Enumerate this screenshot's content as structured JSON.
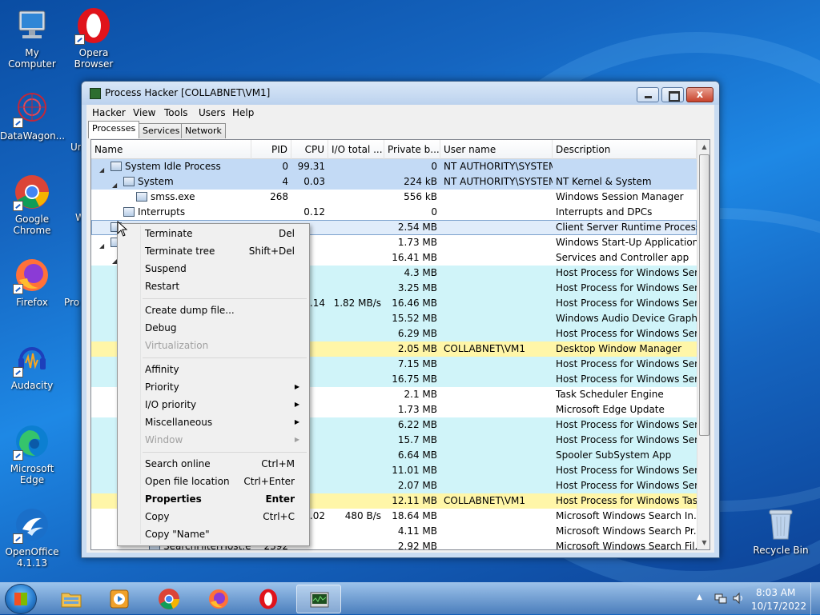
{
  "desktop": {
    "icons": [
      {
        "label": "My Computer"
      },
      {
        "label": "Opera Browser"
      },
      {
        "label": "DataWagon..."
      },
      {
        "label": "Google Chrome"
      },
      {
        "label": "Firefox"
      },
      {
        "label": "Audacity"
      },
      {
        "label": "Microsoft Edge"
      },
      {
        "label": "OpenOffice 4.1.13"
      },
      {
        "label": "Recycle Bin"
      },
      {
        "label": "Ur"
      },
      {
        "label": "W"
      },
      {
        "label": "Pro"
      }
    ]
  },
  "window": {
    "title": "Process Hacker [COLLABNET\\VM1]",
    "close_glyph": "x",
    "menu": [
      "Hacker",
      "View",
      "Tools",
      "Users",
      "Help"
    ],
    "tabs": [
      "Processes",
      "Services",
      "Network"
    ],
    "columns": [
      "Name",
      "PID",
      "CPU",
      "I/O total ...",
      "Private b...",
      "User name",
      "Description"
    ],
    "rows": [
      {
        "name": "System Idle Process",
        "pid": "0",
        "cpu": "99.31",
        "io": "",
        "priv": "0",
        "user": "NT AUTHORITY\\SYSTEM",
        "desc": ""
      },
      {
        "name": "System",
        "pid": "4",
        "cpu": "0.03",
        "io": "",
        "priv": "224 kB",
        "user": "NT AUTHORITY\\SYSTEM",
        "desc": "NT Kernel & System"
      },
      {
        "name": "smss.exe",
        "pid": "268",
        "cpu": "",
        "io": "",
        "priv": "556 kB",
        "user": "",
        "desc": "Windows Session Manager"
      },
      {
        "name": "Interrupts",
        "pid": "",
        "cpu": "0.12",
        "io": "",
        "priv": "0",
        "user": "",
        "desc": "Interrupts and DPCs"
      },
      {
        "name": "",
        "pid": "",
        "cpu": "",
        "io": "",
        "priv": "2.54 MB",
        "user": "",
        "desc": "Client Server Runtime Process"
      },
      {
        "name": "",
        "pid": "",
        "cpu": "",
        "io": "",
        "priv": "1.73 MB",
        "user": "",
        "desc": "Windows Start-Up Application"
      },
      {
        "name": "",
        "pid": "",
        "cpu": "",
        "io": "",
        "priv": "16.41 MB",
        "user": "",
        "desc": "Services and Controller app"
      },
      {
        "name": "",
        "pid": "",
        "cpu": "",
        "io": "",
        "priv": "4.3 MB",
        "user": "",
        "desc": "Host Process for Windows Ser..."
      },
      {
        "name": "",
        "pid": "",
        "cpu": "",
        "io": "",
        "priv": "3.25 MB",
        "user": "",
        "desc": "Host Process for Windows Ser..."
      },
      {
        "name": "",
        "pid": "",
        "cpu": ".14",
        "io": "1.82 MB/s",
        "priv": "16.46 MB",
        "user": "",
        "desc": "Host Process for Windows Ser..."
      },
      {
        "name": "",
        "pid": "",
        "cpu": "",
        "io": "",
        "priv": "15.52 MB",
        "user": "",
        "desc": "Windows Audio Device Graph..."
      },
      {
        "name": "",
        "pid": "",
        "cpu": "",
        "io": "",
        "priv": "6.29 MB",
        "user": "",
        "desc": "Host Process for Windows Ser..."
      },
      {
        "name": "",
        "pid": "",
        "cpu": "",
        "io": "",
        "priv": "2.05 MB",
        "user": "COLLABNET\\VM1",
        "desc": "Desktop Window Manager"
      },
      {
        "name": "",
        "pid": "",
        "cpu": "",
        "io": "",
        "priv": "7.15 MB",
        "user": "",
        "desc": "Host Process for Windows Ser..."
      },
      {
        "name": "",
        "pid": "",
        "cpu": "",
        "io": "",
        "priv": "16.75 MB",
        "user": "",
        "desc": "Host Process for Windows Ser..."
      },
      {
        "name": "",
        "pid": "",
        "cpu": "",
        "io": "",
        "priv": "2.1 MB",
        "user": "",
        "desc": "Task Scheduler Engine"
      },
      {
        "name": "",
        "pid": "",
        "cpu": "",
        "io": "",
        "priv": "1.73 MB",
        "user": "",
        "desc": "Microsoft Edge Update"
      },
      {
        "name": "",
        "pid": "",
        "cpu": "",
        "io": "",
        "priv": "6.22 MB",
        "user": "",
        "desc": "Host Process for Windows Ser..."
      },
      {
        "name": "",
        "pid": "",
        "cpu": "",
        "io": "",
        "priv": "15.7 MB",
        "user": "",
        "desc": "Host Process for Windows Ser..."
      },
      {
        "name": "",
        "pid": "",
        "cpu": "",
        "io": "",
        "priv": "6.64 MB",
        "user": "",
        "desc": "Spooler SubSystem App"
      },
      {
        "name": "",
        "pid": "",
        "cpu": "",
        "io": "",
        "priv": "11.01 MB",
        "user": "",
        "desc": "Host Process for Windows Ser..."
      },
      {
        "name": "",
        "pid": "",
        "cpu": "",
        "io": "",
        "priv": "2.07 MB",
        "user": "",
        "desc": "Host Process for Windows Ser..."
      },
      {
        "name": "",
        "pid": "",
        "cpu": "",
        "io": "",
        "priv": "12.11 MB",
        "user": "COLLABNET\\VM1",
        "desc": "Host Process for Windows Tas..."
      },
      {
        "name": "",
        "pid": "",
        "cpu": ".02",
        "io": "480 B/s",
        "priv": "18.64 MB",
        "user": "",
        "desc": "Microsoft Windows Search In..."
      },
      {
        "name": "",
        "pid": "",
        "cpu": "",
        "io": "",
        "priv": "4.11 MB",
        "user": "",
        "desc": "Microsoft Windows Search Pr..."
      },
      {
        "name": "SearchFilterHost.e...",
        "pid": "2392",
        "cpu": "",
        "io": "",
        "priv": "2.92 MB",
        "user": "",
        "desc": "Microsoft Windows Search Fil..."
      }
    ]
  },
  "context_menu": {
    "items": [
      {
        "label": "Terminate",
        "shortcut": "Del"
      },
      {
        "label": "Terminate tree",
        "shortcut": "Shift+Del"
      },
      {
        "label": "Suspend",
        "shortcut": ""
      },
      {
        "label": "Restart",
        "shortcut": ""
      },
      {
        "label": "Create dump file...",
        "shortcut": ""
      },
      {
        "label": "Debug",
        "shortcut": ""
      },
      {
        "label": "Virtualization",
        "shortcut": ""
      },
      {
        "label": "Affinity",
        "shortcut": ""
      },
      {
        "label": "Priority",
        "shortcut": ""
      },
      {
        "label": "I/O priority",
        "shortcut": ""
      },
      {
        "label": "Miscellaneous",
        "shortcut": ""
      },
      {
        "label": "Window",
        "shortcut": ""
      },
      {
        "label": "Search online",
        "shortcut": "Ctrl+M"
      },
      {
        "label": "Open file location",
        "shortcut": "Ctrl+Enter"
      },
      {
        "label": "Properties",
        "shortcut": "Enter"
      },
      {
        "label": "Copy",
        "shortcut": "Ctrl+C"
      },
      {
        "label": "Copy \"Name\"",
        "shortcut": ""
      }
    ]
  },
  "taskbar": {
    "apps": [
      "file-explorer-icon",
      "media-player-icon",
      "chrome-icon",
      "firefox-icon",
      "opera-icon",
      "process-hacker-icon"
    ],
    "clock": {
      "time": "8:03 AM",
      "date": "10/17/2022"
    }
  },
  "colors": {
    "row_system": "#c3daf5",
    "row_service": "#d0f4f9",
    "row_user": "#fff6a8",
    "row_selected": "#e0ecfa"
  }
}
